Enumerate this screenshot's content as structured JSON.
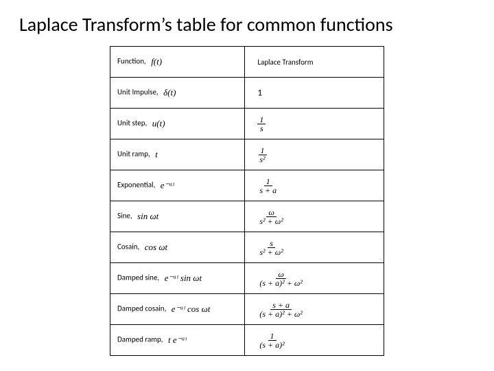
{
  "title": "Laplace Transform’s table for common functions",
  "header": {
    "col1_label": "Function,",
    "col1_math": "f(t)",
    "col2_label": "Laplace Transform"
  },
  "rows": [
    {
      "label": "Unit Impulse,",
      "func": "δ(t)",
      "lt_type": "text",
      "lt": "1"
    },
    {
      "label": "Unit step,",
      "func": "u(t)",
      "lt_type": "frac",
      "num": "1",
      "den": "s"
    },
    {
      "label": "Unit ramp,",
      "func": "t",
      "lt_type": "frac",
      "num": "1",
      "den": "s²"
    },
    {
      "label": "Exponential,",
      "func": "e⁻ᵃᵗ",
      "lt_type": "frac",
      "num": "1",
      "den": "s + a"
    },
    {
      "label": "Sine,",
      "func": "sin ωt",
      "lt_type": "frac",
      "num": "ω",
      "den": "s² + ω²"
    },
    {
      "label": "Cosain,",
      "func": "cos ωt",
      "lt_type": "frac",
      "num": "s",
      "den": "s² + ω²"
    },
    {
      "label": "Damped sine,",
      "func": "e⁻ᵃᵗ sin ωt",
      "lt_type": "frac",
      "num": "ω",
      "den": "(s + a)² + ω²"
    },
    {
      "label": "Damped cosain,",
      "func": "e⁻ᵃᵗ cos ωt",
      "lt_type": "frac",
      "num": "s + a",
      "den": "(s + a)² + ω²"
    },
    {
      "label": "Damped ramp,",
      "func": "t e⁻ᵃᵗ",
      "lt_type": "frac",
      "num": "1",
      "den": "(s + a)²"
    }
  ]
}
